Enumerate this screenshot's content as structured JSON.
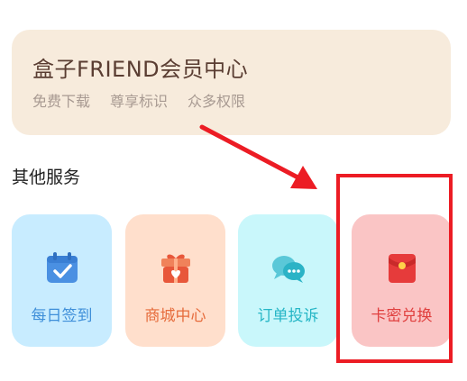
{
  "member": {
    "title": "盒子FRIEND会员中心",
    "tags": [
      "免费下载",
      "尊享标识",
      "众多权限"
    ]
  },
  "section": {
    "title": "其他服务"
  },
  "services": [
    {
      "label": "每日签到",
      "icon": "calendar-check-icon",
      "bg": "#c8ecff",
      "color": "#3f8fd9"
    },
    {
      "label": "商城中心",
      "icon": "gift-box-icon",
      "bg": "#ffdfcc",
      "color": "#e66c3c"
    },
    {
      "label": "订单投诉",
      "icon": "chat-bubbles-icon",
      "bg": "#c9f7fb",
      "color": "#26b6c6"
    },
    {
      "label": "卡密兑换",
      "icon": "red-envelope-icon",
      "bg": "#fac5c5",
      "color": "#e0403f"
    }
  ],
  "annotation": {
    "color": "#ec1c24"
  }
}
